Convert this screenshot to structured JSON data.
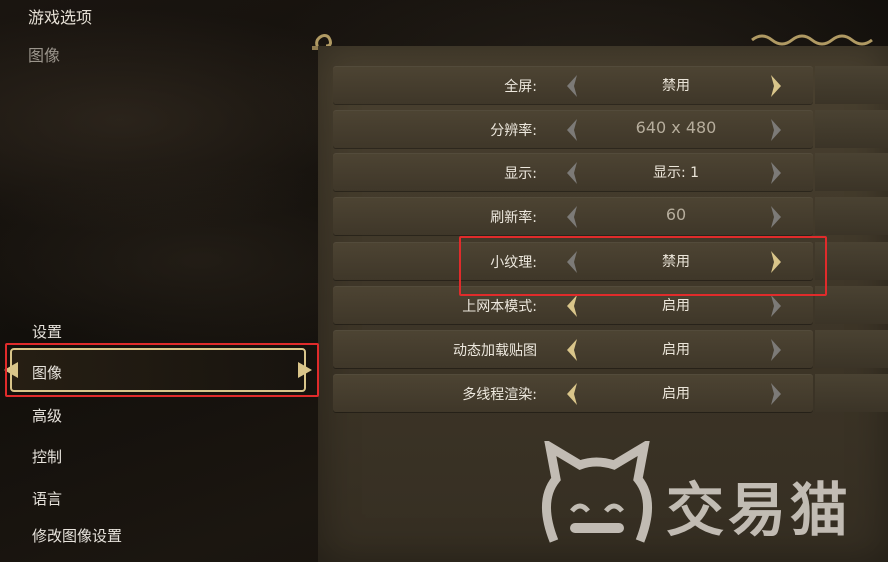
{
  "header": {
    "title": "游戏选项",
    "subtitle": "图像"
  },
  "nav": {
    "items": [
      {
        "label": "设置"
      },
      {
        "label": "图像"
      },
      {
        "label": "高级"
      },
      {
        "label": "控制"
      },
      {
        "label": "语言"
      },
      {
        "label": "修改图像设置"
      }
    ],
    "selected": "图像"
  },
  "settings": [
    {
      "label": "全屏:",
      "value": "禁用"
    },
    {
      "label": "分辨率:",
      "value": "640 x 480"
    },
    {
      "label": "显示:",
      "value": "显示: 1"
    },
    {
      "label": "刷新率:",
      "value": "60"
    },
    {
      "label": "小纹理:",
      "value": "禁用"
    },
    {
      "label": "上网本模式:",
      "value": "启用"
    },
    {
      "label": "动态加载贴图",
      "value": "启用"
    },
    {
      "label": "多线程渲染:",
      "value": "启用"
    }
  ],
  "watermark": {
    "text": "交易猫"
  },
  "colors": {
    "gold": "#d9c58a",
    "highlight_red": "#e02b2b",
    "arrow_inactive": "#7c7a77"
  }
}
